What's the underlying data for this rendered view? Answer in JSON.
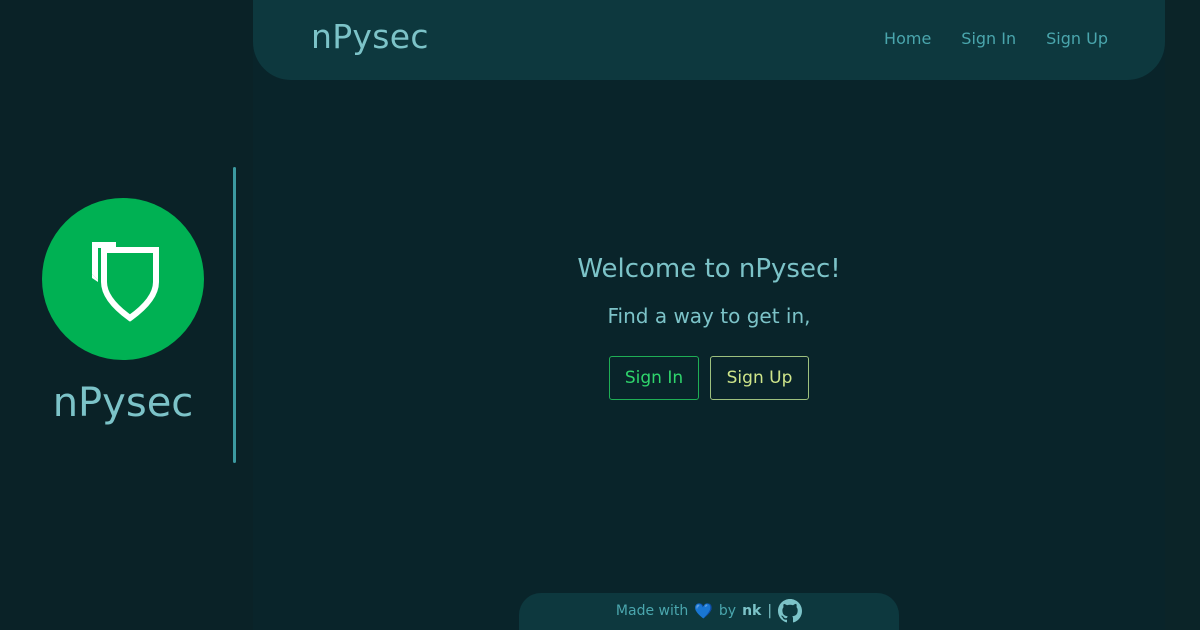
{
  "navbar": {
    "brand": "nPysec",
    "links": [
      "Home",
      "Sign In",
      "Sign Up"
    ]
  },
  "sidebar": {
    "logo_icon": "shield-icon",
    "title": "nPysec"
  },
  "main": {
    "welcome": "Welcome to nPysec!",
    "subtitle": "Find a way to get in,",
    "buttons": {
      "signin": "Sign In",
      "signup": "Sign Up"
    }
  },
  "footer": {
    "made_with": "Made with",
    "heart": "💙",
    "by": "by",
    "author": "nk",
    "separator": "|",
    "github_icon": "github-icon"
  },
  "colors": {
    "background": "#0a2227",
    "navbar": "#0d383e",
    "accent_text": "#7cc3c8",
    "logo_green": "#00b153",
    "signin_green": "#2fd56c",
    "signup_yellow": "#cfe68a"
  }
}
